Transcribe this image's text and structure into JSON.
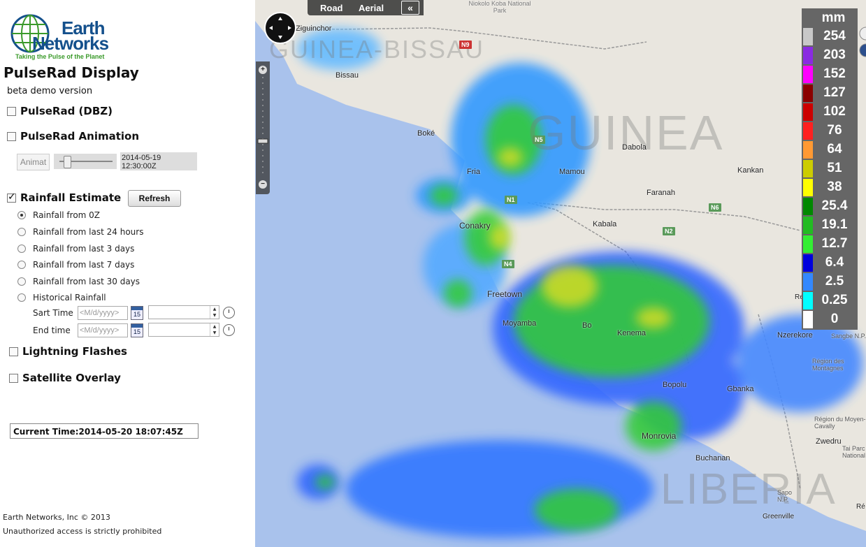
{
  "logo": {
    "line1": "Earth",
    "line2": "Networks",
    "tagline": "Taking the Pulse of the Planet"
  },
  "title": "PulseRad Display",
  "subtitle": "beta demo version",
  "options": {
    "pulserad_dbz": {
      "label": "PulseRad (DBZ)",
      "checked": false
    },
    "pulserad_animation": {
      "label": "PulseRad Animation",
      "checked": false
    },
    "animate_button": "Animat",
    "animation_time": "2014-05-19 12:30:00Z",
    "rainfall_estimate": {
      "label": "Rainfall Estimate",
      "checked": true
    },
    "refresh_button": "Refresh",
    "rainfall_radios": [
      {
        "label": "Rainfall from 0Z",
        "selected": true
      },
      {
        "label": "Rainfall from last 24 hours",
        "selected": false
      },
      {
        "label": "Rainfall from last 3 days",
        "selected": false
      },
      {
        "label": "Rainfall from last 7 days",
        "selected": false
      },
      {
        "label": "Rainfall from last 30 days",
        "selected": false
      },
      {
        "label": "Historical Rainfall",
        "selected": false
      }
    ],
    "start_time_label": "Sart Time",
    "end_time_label": "End time",
    "date_placeholder": "<M/d/yyyy>",
    "calendar_day": "15",
    "lightning": {
      "label": "Lightning Flashes",
      "checked": false
    },
    "satellite": {
      "label": "Satellite Overlay",
      "checked": false
    }
  },
  "current_time": "Current Time:2014-05-20 18:07:45Z",
  "footer": {
    "copyright": "Earth Networks, Inc © 2013",
    "notice": "Unauthorized access is strictly prohibited"
  },
  "map": {
    "view_buttons": {
      "road": "Road",
      "aerial": "Aerial",
      "collapse": "«"
    },
    "cities": [
      "Ziguinchor",
      "Bissau",
      "Boké",
      "Fria",
      "Mamou",
      "Dabola",
      "Faranah",
      "Kankan",
      "Conakry",
      "Kabala",
      "Freetown",
      "Moyamba",
      "Bo",
      "Kenema",
      "Nzerekore",
      "Bopolu",
      "Gbanka",
      "Monrovia",
      "Buchanan",
      "Zwedru",
      "Greenville",
      "Sangbe N.P.",
      "Région des Montagnes",
      "Région du Moyen-Cavally",
      "Tai Parc National",
      "Sapo N.P.",
      "Niokolo Koba National Park",
      "Re",
      "Ré"
    ],
    "countries": [
      "GUINEA-BISSAU",
      "GUINEA",
      "LIBERIA"
    ],
    "road_shields": [
      "N9",
      "N5",
      "N1",
      "N4",
      "N6",
      "N2"
    ],
    "legend": {
      "unit": "mm",
      "entries": [
        {
          "value": "254",
          "color": "#c8c8c8"
        },
        {
          "value": "203",
          "color": "#8a2be2"
        },
        {
          "value": "152",
          "color": "#ff00ff"
        },
        {
          "value": "127",
          "color": "#8b0000"
        },
        {
          "value": "102",
          "color": "#cc0000"
        },
        {
          "value": "76",
          "color": "#ff2020"
        },
        {
          "value": "64",
          "color": "#ff9933"
        },
        {
          "value": "51",
          "color": "#cccc00"
        },
        {
          "value": "38",
          "color": "#ffff00"
        },
        {
          "value": "25.4",
          "color": "#008800"
        },
        {
          "value": "19.1",
          "color": "#22bb22"
        },
        {
          "value": "12.7",
          "color": "#33ee33"
        },
        {
          "value": "6.4",
          "color": "#0000dd"
        },
        {
          "value": "2.5",
          "color": "#3388ff"
        },
        {
          "value": "0.25",
          "color": "#00ffff"
        },
        {
          "value": "0",
          "color": "#ffffff"
        }
      ]
    }
  }
}
